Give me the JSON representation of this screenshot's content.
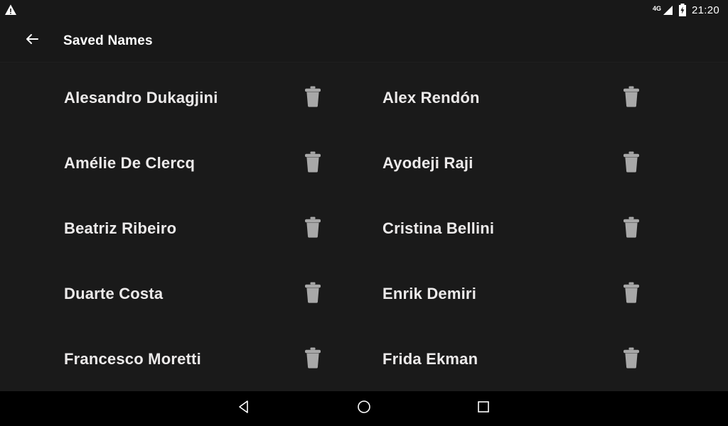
{
  "status_bar": {
    "alert_icon": "warning-triangle-icon",
    "network_label": "4G",
    "signal_icon": "signal-bars-icon",
    "battery_icon": "battery-charging-icon",
    "clock": "21:20"
  },
  "toolbar": {
    "back_icon": "arrow-left-icon",
    "title": "Saved Names"
  },
  "names": {
    "delete_icon": "trash-icon",
    "items": [
      {
        "name": "Alesandro Dukagjini",
        "column": "left"
      },
      {
        "name": "Alex Rendón",
        "column": "right"
      },
      {
        "name": "Amélie De Clercq",
        "column": "left"
      },
      {
        "name": "Ayodeji Raji",
        "column": "right"
      },
      {
        "name": "Beatriz Ribeiro",
        "column": "left"
      },
      {
        "name": "Cristina Bellini",
        "column": "right"
      },
      {
        "name": "Duarte Costa",
        "column": "left"
      },
      {
        "name": "Enrik Demiri",
        "column": "right"
      },
      {
        "name": "Francesco Moretti",
        "column": "left"
      },
      {
        "name": "Frida Ekman",
        "column": "right"
      }
    ]
  },
  "nav_bar": {
    "back": "back-triangle-icon",
    "home": "home-circle-icon",
    "recents": "recents-square-icon"
  },
  "colors": {
    "window_background": "#181818",
    "content_background": "#1a1a1a",
    "nav_background": "#000000",
    "text_primary": "#ffffff",
    "text_name": "#eceaea",
    "icon_gray": "#a8a8a8"
  }
}
